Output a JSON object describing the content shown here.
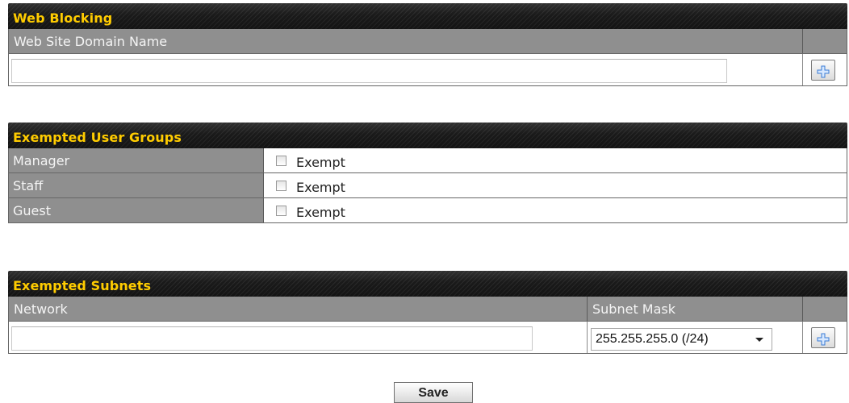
{
  "web_blocking": {
    "title": "Web Blocking",
    "column_header": "Web Site Domain Name",
    "domain_input_value": "",
    "add_button_icon": "plus-icon"
  },
  "exempted_user_groups": {
    "title": "Exempted User Groups",
    "groups": [
      {
        "label": "Manager",
        "checkbox_label": "Exempt",
        "checked": false
      },
      {
        "label": "Staff",
        "checkbox_label": "Exempt",
        "checked": false
      },
      {
        "label": "Guest",
        "checkbox_label": "Exempt",
        "checked": false
      }
    ]
  },
  "exempted_subnets": {
    "title": "Exempted Subnets",
    "network_header": "Network",
    "mask_header": "Subnet Mask",
    "network_input_value": "",
    "mask_selected": "255.255.255.0 (/24)",
    "add_button_icon": "plus-icon"
  },
  "save_label": "Save",
  "colors": {
    "header_bg": "#1a1a1a",
    "header_text": "#ffcc00",
    "column_header_bg": "#8f8f8f",
    "plus_icon": "#3a7bd5"
  }
}
